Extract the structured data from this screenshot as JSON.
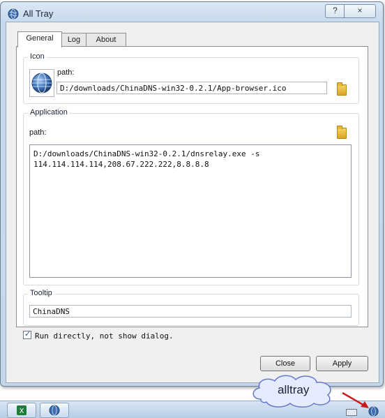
{
  "window": {
    "title": "All Tray",
    "help_label": "?",
    "close_label": "×"
  },
  "tabs": [
    {
      "label": "General"
    },
    {
      "label": "Log"
    },
    {
      "label": "About"
    }
  ],
  "icon_group": {
    "label": "Icon",
    "path_label": "path:",
    "path_value": "D:/downloads/ChinaDNS-win32-0.2.1/App-browser.ico"
  },
  "application_group": {
    "label": "Application",
    "path_label": "path:",
    "path_line1": "D:/downloads/ChinaDNS-win32-0.2.1/dnsrelay.exe -s",
    "path_line2": "114.114.114.114,208.67.222.222,8.8.8.8"
  },
  "tooltip_group": {
    "label": "Tooltip",
    "value": "ChinaDNS"
  },
  "run_directly": {
    "label": "Run directly, not show dialog.",
    "checked": true
  },
  "buttons": {
    "close": "Close",
    "apply": "Apply"
  },
  "callout": {
    "text": "alltray"
  },
  "colors": {
    "title_gradient_top": "#dbe8f5",
    "panel_bg": "#f0f0f0",
    "arrow": "#cc1a1a"
  }
}
